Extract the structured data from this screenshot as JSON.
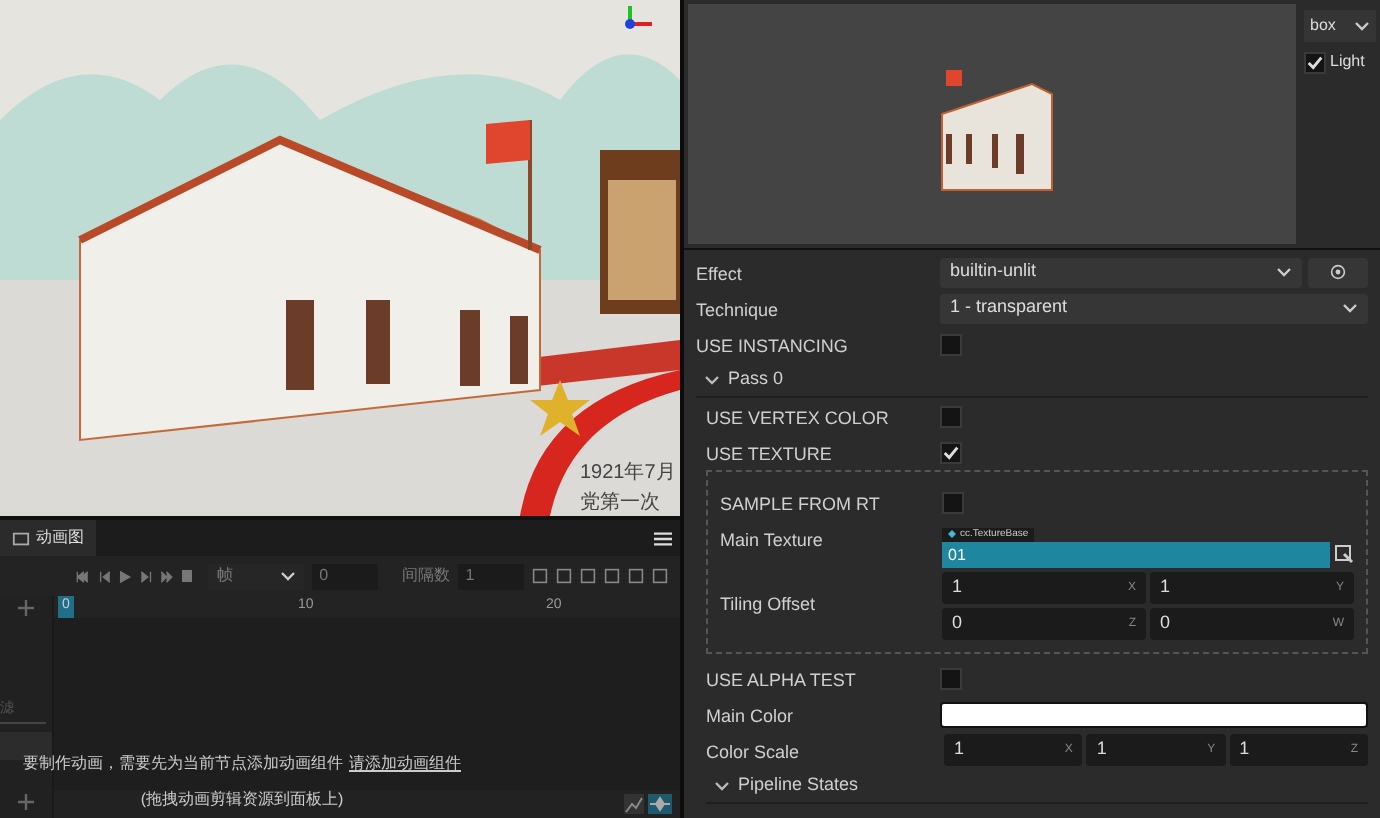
{
  "scene": {
    "texts": [
      "1921年7月",
      "党第一次"
    ]
  },
  "animation_panel": {
    "tab": {
      "label": "动画图",
      "selected": true
    },
    "toolbar": {
      "mode_select": "帧",
      "frame_input": "0",
      "interval_label": "间隔数",
      "interval_input": "1"
    },
    "ruler_ticks": [
      "0",
      "10",
      "20"
    ],
    "filter_placeholder": "滤",
    "message": "要制作动画，需要先为当前节点添加动画组件",
    "message_link": "请添加动画组件",
    "hint": "(拖拽动画剪辑资源到面板上)"
  },
  "preview": {
    "mesh_select": "box",
    "light": {
      "label": "Light",
      "checked": true
    }
  },
  "inspector": {
    "effect": {
      "label": "Effect",
      "value": "builtin-unlit"
    },
    "technique": {
      "label": "Technique",
      "value": "1 - transparent"
    },
    "use_instancing": {
      "label": "USE INSTANCING",
      "checked": false
    },
    "pass": {
      "label": "Pass 0",
      "expanded": true,
      "rows": [
        {
          "kind": "check",
          "label": "USE VERTEX COLOR",
          "checked": false
        },
        {
          "kind": "check",
          "label": "USE TEXTURE",
          "checked": true
        }
      ],
      "texture_group": {
        "sample_from_rt": {
          "label": "SAMPLE FROM RT",
          "checked": false
        },
        "main_texture": {
          "label": "Main Texture",
          "type_tag": "cc.TextureBase",
          "value": "01"
        },
        "tiling_offset": {
          "label": "Tiling Offset",
          "fields": [
            {
              "value": "1",
              "axis": "X"
            },
            {
              "value": "1",
              "axis": "Y"
            },
            {
              "value": "0",
              "axis": "Z"
            },
            {
              "value": "0",
              "axis": "W"
            }
          ]
        }
      },
      "use_alpha_test": {
        "label": "USE ALPHA TEST",
        "checked": false
      },
      "main_color": {
        "label": "Main Color",
        "color": "#ffffff"
      },
      "color_scale": {
        "label": "Color Scale",
        "fields": [
          {
            "value": "1",
            "axis": "X"
          },
          {
            "value": "1",
            "axis": "Y"
          },
          {
            "value": "1",
            "axis": "Z"
          }
        ]
      },
      "pipeline": {
        "label": "Pipeline States",
        "expanded": true
      }
    }
  }
}
